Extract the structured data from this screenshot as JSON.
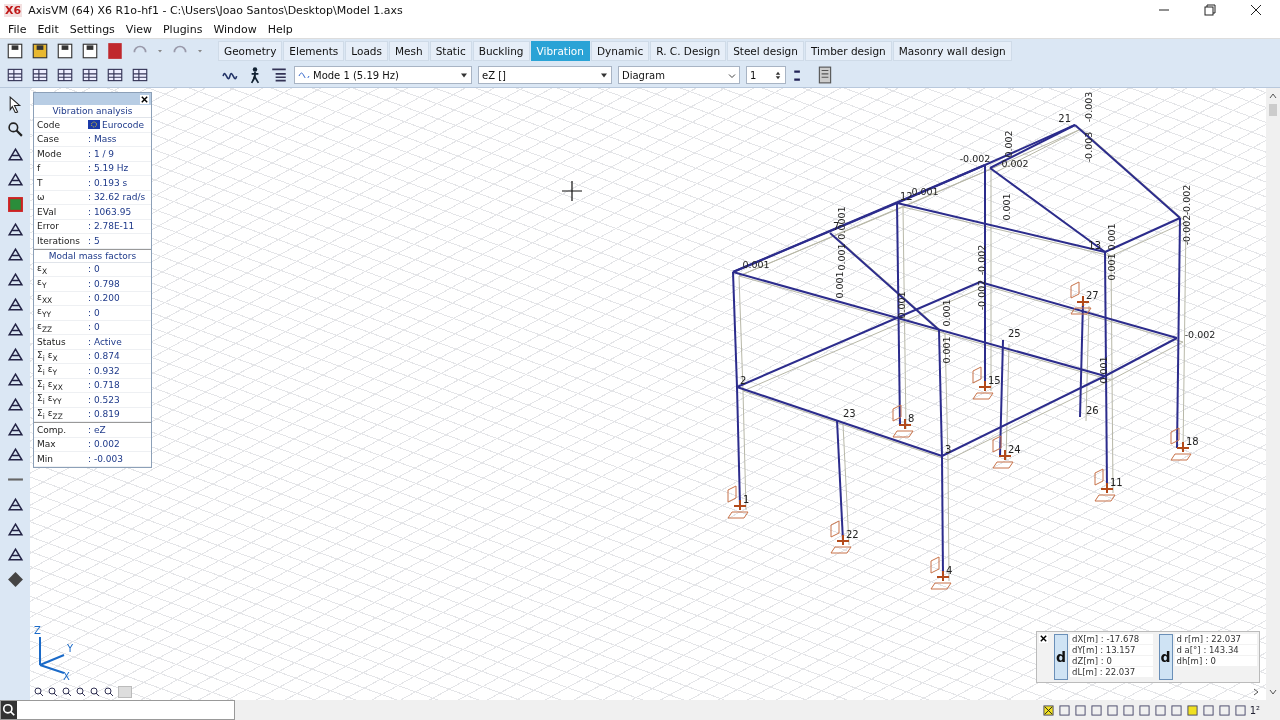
{
  "window": {
    "title": "AxisVM (64) X6 R1o-hf1 - C:\\Users\\Joao Santos\\Desktop\\Model 1.axs",
    "app_mark": "X6"
  },
  "menu": [
    "File",
    "Edit",
    "Settings",
    "View",
    "Plugins",
    "Window",
    "Help"
  ],
  "tabs": [
    {
      "label": "Geometry",
      "selected": false
    },
    {
      "label": "Elements",
      "selected": false
    },
    {
      "label": "Loads",
      "selected": false
    },
    {
      "label": "Mesh",
      "selected": false
    },
    {
      "label": "Static",
      "selected": false
    },
    {
      "label": "Buckling",
      "selected": false
    },
    {
      "label": "Vibration",
      "selected": true
    },
    {
      "label": "Dynamic",
      "selected": false
    },
    {
      "label": "R. C. Design",
      "selected": false
    },
    {
      "label": "Steel design",
      "selected": false
    },
    {
      "label": "Timber design",
      "selected": false
    },
    {
      "label": "Masonry wall design",
      "selected": false
    }
  ],
  "toolbar": {
    "mode": "Mode 1  (5.19 Hz)",
    "component": "eZ []",
    "display": "Diagram",
    "scale": "1"
  },
  "info_panel": {
    "title": "Vibration analysis",
    "rows": [
      {
        "kind": "flag",
        "label": "Code",
        "value": "Eurocode"
      },
      {
        "kind": "row",
        "label": "Case",
        "value": ": Mass"
      },
      {
        "kind": "row",
        "label": "Mode",
        "value": ": 1 / 9"
      },
      {
        "kind": "row",
        "label": "f",
        "value": ": 5.19 Hz"
      },
      {
        "kind": "row",
        "label": "T",
        "value": ": 0.193 s"
      },
      {
        "kind": "row",
        "label": "ω",
        "value": ": 32.62 rad/s"
      },
      {
        "kind": "row",
        "label": "EVal",
        "value": ": 1063.95"
      },
      {
        "kind": "row",
        "label": "Error",
        "value": ": 2.78E-11"
      },
      {
        "kind": "row",
        "label": "Iterations",
        "value": ": 5"
      },
      {
        "kind": "header",
        "label": "Modal mass factors"
      },
      {
        "kind": "row",
        "label": "ε$_{X}$",
        "value": ": 0"
      },
      {
        "kind": "row",
        "label": "ε$_{Y}$",
        "value": ": 0.798"
      },
      {
        "kind": "row",
        "label": "ε$_{XX}$",
        "value": ": 0.200"
      },
      {
        "kind": "row",
        "label": "ε$_{YY}$",
        "value": ": 0"
      },
      {
        "kind": "row",
        "label": "ε$_{ZZ}$",
        "value": ": 0"
      },
      {
        "kind": "row",
        "label": "Status",
        "value": ": Active"
      },
      {
        "kind": "row",
        "label": "Σ$_{i}$ ε$_{X}$",
        "value": ": 0.874"
      },
      {
        "kind": "row",
        "label": "Σ$_{i}$ ε$_{Y}$",
        "value": ": 0.932"
      },
      {
        "kind": "row",
        "label": "Σ$_{i}$ ε$_{XX}$",
        "value": ": 0.718"
      },
      {
        "kind": "row",
        "label": "Σ$_{i}$ ε$_{YY}$",
        "value": ": 0.523"
      },
      {
        "kind": "row",
        "label": "Σ$_{i}$ ε$_{ZZ}$",
        "value": ": 0.819"
      },
      {
        "kind": "rule",
        "label": "Comp.",
        "value": ": eZ"
      },
      {
        "kind": "row",
        "label": "Max",
        "value": ": 0.002"
      },
      {
        "kind": "row",
        "label": "Min",
        "value": ": -0.003"
      }
    ]
  },
  "model": {
    "node_labels": [
      "1",
      "2",
      "3",
      "4",
      "7",
      "8",
      "11",
      "12",
      "13",
      "15",
      "18",
      "21",
      "22",
      "23",
      "24",
      "25",
      "27",
      "26"
    ],
    "values": [
      "-0.003",
      "-0.003",
      "0.002",
      "-0.002",
      "0.002",
      "0.001",
      "0.001",
      "0.0001",
      "0.001",
      "0.001",
      "0.001",
      "-0.002",
      "-0.002",
      "0.001",
      "0.001",
      "-0.002",
      "-0.002",
      "0.001",
      "0.001",
      "0.001",
      "-0.002",
      "0.001"
    ],
    "axes": [
      "Z",
      "Y",
      "X"
    ]
  },
  "coords": {
    "left_mark": "d",
    "left": [
      "dX[m] : -17.678",
      "dY[m] : 13.157",
      "dZ[m] : 0",
      "dL[m] : 22.037"
    ],
    "right_mark": "d",
    "right": [
      "d r[m] : 22.037",
      "d  a[°] : 143.34",
      "dh[m] : 0"
    ]
  },
  "status_text": "1²"
}
